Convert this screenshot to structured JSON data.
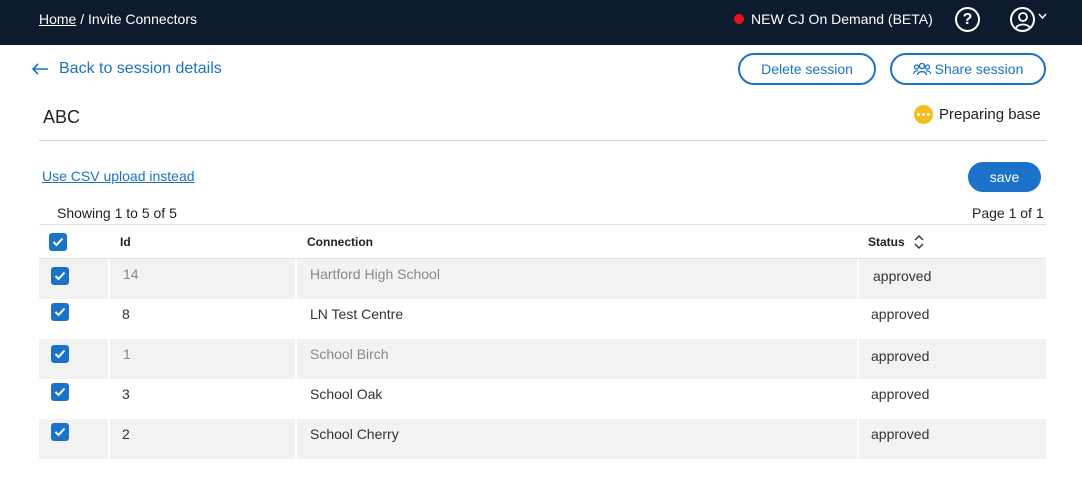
{
  "header": {
    "breadcrumb_home": "Home",
    "breadcrumb_sep": " / ",
    "breadcrumb_current": "Invite Connectors",
    "env_label": "NEW CJ On Demand (BETA)",
    "help_icon": "?",
    "env_dot_color": "#e8101a"
  },
  "toolbar": {
    "back_label": "Back to session details",
    "delete_label": "Delete session",
    "share_label": "Share session"
  },
  "session": {
    "title": "ABC",
    "status": "Preparing base"
  },
  "actions": {
    "csv_link": "Use CSV upload instead",
    "save_label": "save"
  },
  "table": {
    "showing": "Showing 1 to 5 of 5",
    "page": "Page 1  of 1",
    "columns": {
      "id": "Id",
      "connection": "Connection",
      "status": "Status"
    },
    "rows": [
      {
        "id": "14",
        "connection": "Hartford High School",
        "status": "approved",
        "checked": true
      },
      {
        "id": "8",
        "connection": "LN Test Centre",
        "status": "approved",
        "checked": true
      },
      {
        "id": "1",
        "connection": "School Birch",
        "status": "approved",
        "checked": true
      },
      {
        "id": "3",
        "connection": "School Oak",
        "status": "approved",
        "checked": true
      },
      {
        "id": "2",
        "connection": "School Cherry",
        "status": "approved",
        "checked": true
      }
    ]
  },
  "colors": {
    "topbar": "#0c1b2e",
    "accent": "#1a73c9",
    "pending": "#f5be1c"
  }
}
